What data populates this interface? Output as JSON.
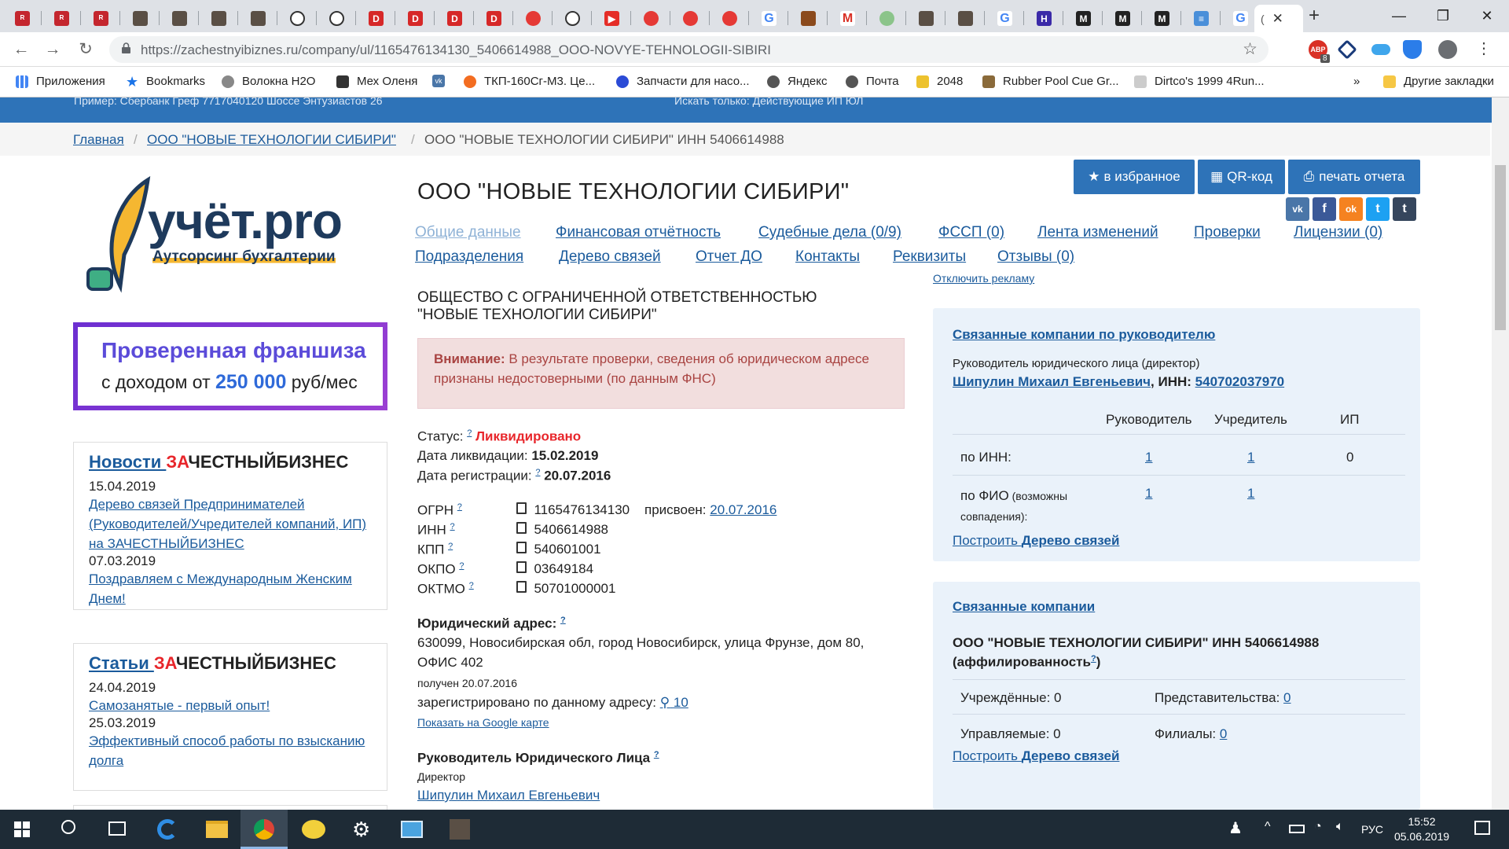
{
  "browser": {
    "active_tab_title": "(",
    "url": "https://zachestnyibiznes.ru/company/ul/1165476134130_5406614988_OOO-NOVYE-TEHNOLOGII-SIBIRI",
    "bookmarks": [
      "Приложения",
      "Bookmarks",
      "Волокна Н2О",
      "Мех Оленя",
      "ТКП-160Сг-М3. Це...",
      "Запчасти для насо...",
      "Яндекс",
      "Почта",
      "2048",
      "Rubber Pool Cue Gr...",
      "Dirtco's 1999 4Run...",
      "»",
      "Другие закладки"
    ],
    "ext_badge": "8",
    "tab_badge_yt": "▶"
  },
  "site": {
    "ghost_line_left": "Пример: Сбербанк Греф  7717040120  Шоссе Энтузиастов 26",
    "ghost_line_right": "Искать только:  Действующие  ИП  ЮЛ",
    "breadcrumbs": [
      "Главная",
      "/",
      "ООО \"НОВЫЕ ТЕХНОЛОГИИ СИБИРИ\"",
      "/",
      "ООО \"НОВЫЕ ТЕХНОЛОГИИ СИБИРИ\" ИНН 5406614988"
    ],
    "logo_text": "учёт.pro",
    "logo_sub": "Аутсорсинг бухгалтерии",
    "banner_line1": "Проверенная франшиза",
    "banner_line2a": "с доходом от ",
    "banner_line2b": "250 000",
    "banner_line2c": " руб/мес",
    "news": {
      "title_a": "Новости ",
      "title_b": "ЗА",
      "title_c": "ЧЕСТНЫЙБИЗНЕС",
      "items": [
        {
          "date": "15.04.2019",
          "text": "Дерево связей Предпринимателей (Руководителей/Учредителей компаний, ИП) на ЗАЧЕСТНЫЙБИЗНЕС"
        },
        {
          "date": "07.03.2019",
          "text": "Поздравляем с Международным Женским Днем!"
        }
      ]
    },
    "articles": {
      "title_a": "Статьи ",
      "title_b": "ЗА",
      "title_c": "ЧЕСТНЫЙБИЗНЕС",
      "items": [
        {
          "date": "24.04.2019",
          "text": "Самозанятые - первый опыт!"
        },
        {
          "date": "25.03.2019",
          "text": "Эффективный способ работы по взысканию долга"
        }
      ]
    }
  },
  "company": {
    "title": "ООО \"НОВЫЕ ТЕХНОЛОГИИ СИБИРИ\"",
    "buttons": {
      "favorite": "в избранное",
      "qr": "QR-код",
      "print": "печать отчета"
    },
    "social": [
      "vk",
      "f",
      "ok",
      "t",
      "t"
    ],
    "tabs_row1": [
      "Общие данные",
      "Финансовая отчётность",
      "Судебные дела (0/9)",
      "ФССП (0)",
      "Лента изменений",
      "Проверки",
      "Лицензии (0)"
    ],
    "tabs_row2": [
      "Подразделения",
      "Дерево связей",
      "Отчет ДО",
      "Контакты",
      "Реквизиты",
      "Отзывы (0)"
    ],
    "disable_ads": "Отключить рекламу",
    "full_name_1": "ОБЩЕСТВО С ОГРАНИЧЕННОЙ ОТВЕТСТВЕННОСТЬЮ",
    "full_name_2": "\"НОВЫЕ ТЕХНОЛОГИИ СИБИРИ\"",
    "warning_label": "Внимание:",
    "warning_text": " В результате проверки, сведения об юридическом адресе признаны недостоверными (по данным ФНС)",
    "status_label": "Статус:",
    "status_value": "Ликвидировано",
    "liq_label": "Дата ликвидации:",
    "liq_value": "15.02.2019",
    "reg_label": "Дата регистрации:",
    "reg_value": "20.07.2016",
    "help": "?",
    "codes": [
      {
        "label": "ОГРН",
        "value": "1165476134130"
      },
      {
        "label": "ИНН",
        "value": "5406614988"
      },
      {
        "label": "КПП",
        "value": "540601001"
      },
      {
        "label": "ОКПО",
        "value": "03649184"
      },
      {
        "label": "ОКТМО",
        "value": "50701000001"
      }
    ],
    "ogrn_assigned_label": "присвоен:",
    "ogrn_assigned_date": "20.07.2016",
    "address_label": "Юридический адрес:",
    "address_1": "630099, Новосибирская обл, город Новосибирск, улица Фрунзе, дом 80,",
    "address_2": "ОФИС 402",
    "address_received": "получен 20.07.2016",
    "address_registered": "зарегистрировано по данному адресу:",
    "address_count": "10",
    "google_map": "Показать на Google карте",
    "head_label": "Руководитель Юридического Лица",
    "head_role": "Директор",
    "head_name": "Шипулин Михаил Евгеньевич"
  },
  "related_by_head": {
    "title": "Связанные компании по руководителю",
    "role": "Руководитель юридического лица (директор)",
    "name": "Шипулин Михаил Евгеньевич",
    "inn_label": ", ИНН: ",
    "inn": "540702037970",
    "cols": [
      "Руководитель",
      "Учредитель",
      "ИП"
    ],
    "rows": [
      {
        "label": "по ИНН:",
        "sub": "",
        "values": [
          "1",
          "1",
          "0"
        ]
      },
      {
        "label": "по ФИО",
        "sub": " (возможны совпадения):",
        "values": [
          "1",
          "1",
          ""
        ]
      }
    ],
    "tree_a": "Построить ",
    "tree_b": "Дерево связей"
  },
  "related": {
    "title": "Связанные компании",
    "company_line": "ООО \"НОВЫЕ ТЕХНОЛОГИИ СИБИРИ\" ИНН 5406614988",
    "affil": "(аффилированность",
    "affil_close": ")",
    "founded": "Учреждённые: 0",
    "repr_label": "Представительства: ",
    "repr_value": "0",
    "managed": "Управляемые: 0",
    "branch_label": "Филиалы: ",
    "branch_value": "0",
    "tree_a": "Построить ",
    "tree_b": "Дерево связей"
  },
  "taskbar": {
    "time": "15:52",
    "date": "05.06.2019",
    "lang": "РУС"
  },
  "colors": {
    "accent": "#2e73b8",
    "link": "#1b5b9c",
    "red": "#e8262b"
  }
}
